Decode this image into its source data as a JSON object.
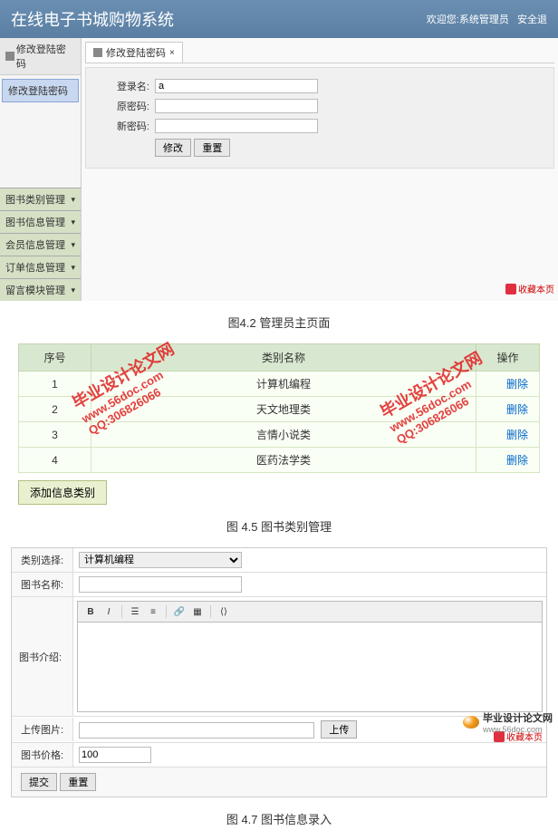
{
  "section1": {
    "header_title": "在线电子书城购物系统",
    "welcome": "欢迎您:系统管理员",
    "security": "安全退",
    "sidebar_top": "修改登陆密码",
    "sidebar_active": "修改登陆密码",
    "sidebar_items": [
      "图书类别管理",
      "图书信息管理",
      "会员信息管理",
      "订单信息管理",
      "留言模块管理"
    ],
    "tab_label": "修改登陆密码",
    "form": {
      "username_label": "登录名:",
      "username_value": "a",
      "oldpwd_label": "原密码:",
      "newpwd_label": "新密码:",
      "modify_btn": "修改",
      "reset_btn": "重置"
    },
    "fav_label": "收藏本页"
  },
  "caption1": "图4.2 管理员主页面",
  "section2": {
    "headers": [
      "序号",
      "类别名称",
      "操作"
    ],
    "rows": [
      {
        "no": "1",
        "name": "计算机编程",
        "action": "删除"
      },
      {
        "no": "2",
        "name": "天文地理类",
        "action": "删除"
      },
      {
        "no": "3",
        "name": "言情小说类",
        "action": "删除"
      },
      {
        "no": "4",
        "name": "医药法学类",
        "action": "删除"
      }
    ],
    "add_btn": "添加信息类别"
  },
  "caption2": "图 4.5 图书类别管理",
  "section3": {
    "cat_label": "类别选择:",
    "cat_value": "计算机编程",
    "name_label": "图书名称:",
    "intro_label": "图书介绍:",
    "upload_label": "上传图片:",
    "upload_btn": "上传",
    "price_label": "图书价格:",
    "price_value": "100",
    "submit_btn": "提交",
    "reset_btn": "重置",
    "fav_label": "收藏本页"
  },
  "caption3": "图 4.7 图书信息录入",
  "watermark": {
    "line1": "毕业设计论文网",
    "line2": "www.56doc.com",
    "line3": "QQ:306826066"
  },
  "footer": {
    "name": "毕业设计论文网",
    "url": "www.56doc.com"
  }
}
